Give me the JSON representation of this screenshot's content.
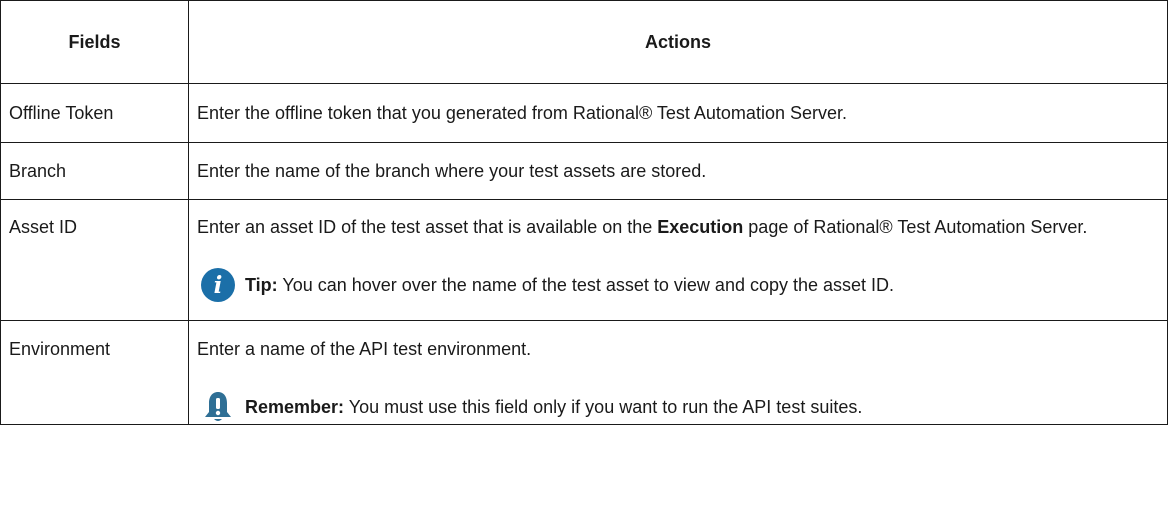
{
  "table": {
    "headers": {
      "fields": "Fields",
      "actions": "Actions"
    },
    "rows": [
      {
        "field": "Offline Token",
        "action": "Enter the offline token that you generated from Rational® Test Automation Server."
      },
      {
        "field": "Branch",
        "action": "Enter the name of the branch where your test assets are stored."
      },
      {
        "field": "Asset ID",
        "action_prefix": "Enter an asset ID of the test asset that is available on the ",
        "action_bold": "Execution",
        "action_suffix": " page of Rational® Test Automation Server.",
        "note": {
          "icon": "info-icon",
          "label": "Tip:",
          "text": " You can hover over the name of the test asset to view and copy the asset ID.",
          "color": "#1b6fa8"
        }
      },
      {
        "field": "Environment",
        "action": "Enter a name of the API test environment.",
        "note": {
          "icon": "bell-icon",
          "label": "Remember:",
          "text": " You must use this field only if you want to run the API test suites.",
          "color": "#2f6f95"
        }
      }
    ]
  }
}
